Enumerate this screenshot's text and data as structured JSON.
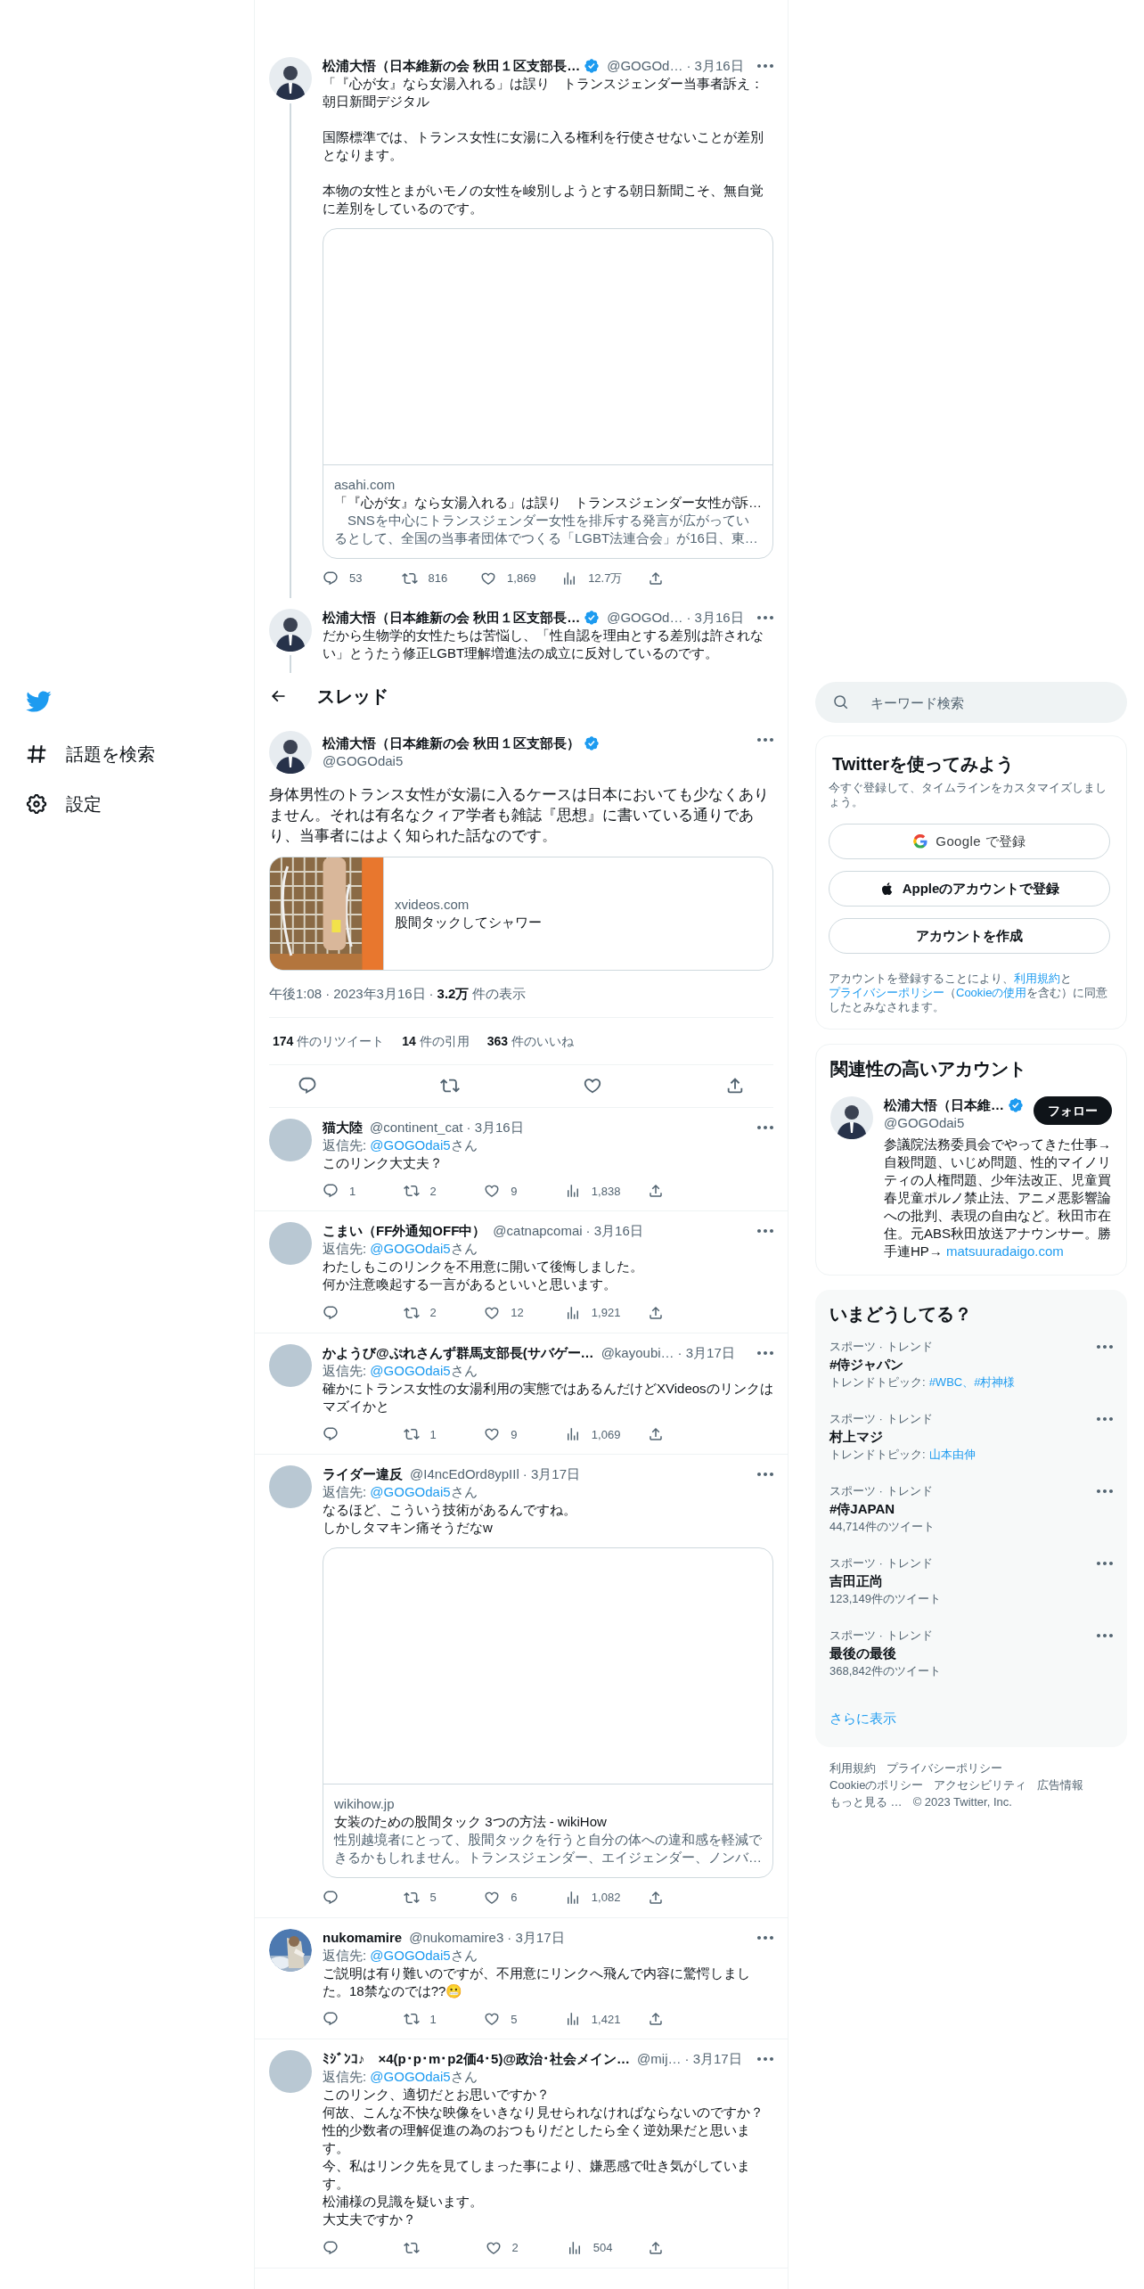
{
  "nav": {
    "items": [
      {
        "label": "話題を検索",
        "kind": "hash"
      },
      {
        "label": "設定",
        "kind": "gear"
      }
    ]
  },
  "context_tweets": [
    {
      "avatar": {
        "kind": "silhouette"
      },
      "name": "松浦大悟（日本維新の会 秋田１区支部長…",
      "verified": true,
      "handle": "@GOGOd…",
      "date": "· 3月16日",
      "paragraphs": [
        "「『心が女』なら女湯入れる」は誤り　トランスジェンダー当事者訴え：朝日新聞デジタル",
        "国際標準では、トランス女性に女湯に入る権利を行使させないことが差別となります。",
        "本物の女性とまがいモノの女性を峻別しようとする朝日新聞こそ、無自覚に差別をしているのです。"
      ],
      "card": {
        "kind": "large",
        "domain": "asahi.com",
        "title": "「『心が女』なら女湯入れる」は誤り　トランスジェンダー女性が訴…",
        "description": "　SNSを中心にトランスジェンダー女性を排斥する発言が広がっているとして、全国の当事者団体でつくる「LGBT法連合会」が16日、東…"
      },
      "actions": [
        {
          "kind": "reply",
          "count": "53"
        },
        {
          "kind": "retweet",
          "count": "816"
        },
        {
          "kind": "like",
          "count": "1,869"
        },
        {
          "kind": "views",
          "count": "12.7万"
        },
        {
          "kind": "share"
        }
      ]
    },
    {
      "avatar": {
        "kind": "silhouette"
      },
      "name": "松浦大悟（日本維新の会 秋田１区支部長…",
      "verified": true,
      "handle": "@GOGOd…",
      "date": "· 3月16日",
      "lines": [
        "だから生物学的女性たちは苦悩し、「性自認を理由とする差別は許されない」とうたう修正LGBT理解増進法の成立に反対しているのです。"
      ]
    }
  ],
  "header": {
    "title": "スレッド"
  },
  "main_tweet": {
    "avatar": {
      "kind": "silhouette"
    },
    "name": "松浦大悟（日本維新の会 秋田１区支部長）",
    "verified": true,
    "handle": "@GOGOdai5",
    "lines": [
      "身体男性のトランス女性が女湯に入るケースは日本においても少なくありません。それは有名なクィア学者も雑誌『思想』に書いている通りであり、当事者にはよく知られた話なのです。"
    ],
    "card": {
      "kind": "small",
      "domain": "xvideos.com",
      "title": "股間タックしてシャワー"
    },
    "meta": [
      {
        "kind": "text",
        "text": "午後1:08"
      },
      {
        "kind": "sep",
        "text": "·"
      },
      {
        "kind": "text",
        "text": "2023年3月16日"
      },
      {
        "kind": "sep",
        "text": "·"
      },
      {
        "kind": "count",
        "text": "3.2万"
      },
      {
        "kind": "text",
        "text": "件の表示"
      }
    ],
    "stats": [
      {
        "count": "174",
        "label": "件のリツイート"
      },
      {
        "count": "14",
        "label": "件の引用"
      },
      {
        "count": "363",
        "label": "件のいいね"
      }
    ],
    "actions": [
      {
        "kind": "reply"
      },
      {
        "kind": "retweet"
      },
      {
        "kind": "like"
      },
      {
        "kind": "share"
      }
    ]
  },
  "replies": [
    {
      "avatar": {
        "kind": "plain"
      },
      "name": "猫大陸",
      "verified": false,
      "handle": "@continent_cat",
      "date": "· 3月16日",
      "reply_to": {
        "label": "返信先:",
        "handle": "@GOGOdai5",
        "suffix": "さん"
      },
      "lines": [
        "このリンク大丈夫？"
      ],
      "actions": [
        {
          "kind": "reply",
          "count": "1"
        },
        {
          "kind": "retweet",
          "count": "2"
        },
        {
          "kind": "like",
          "count": "9"
        },
        {
          "kind": "views",
          "count": "1,838"
        },
        {
          "kind": "share"
        }
      ]
    },
    {
      "avatar": {
        "kind": "plain"
      },
      "name": "こまい（FF外通知OFF中）",
      "verified": false,
      "handle": "@catnapcomai",
      "date": "· 3月16日",
      "reply_to": {
        "label": "返信先:",
        "handle": "@GOGOdai5",
        "suffix": "さん"
      },
      "lines": [
        "わたしもこのリンクを不用意に開いて後悔しました。",
        "何か注意喚起する一言があるといいと思います。"
      ],
      "actions": [
        {
          "kind": "reply"
        },
        {
          "kind": "retweet",
          "count": "2"
        },
        {
          "kind": "like",
          "count": "12"
        },
        {
          "kind": "views",
          "count": "1,921"
        },
        {
          "kind": "share"
        }
      ]
    },
    {
      "avatar": {
        "kind": "plain"
      },
      "name": "かようび@ぷれさんず群馬支部長(サバゲー…",
      "verified": false,
      "handle": "@kayoubi…",
      "date": "· 3月17日",
      "reply_to": {
        "label": "返信先:",
        "handle": "@GOGOdai5",
        "suffix": "さん"
      },
      "lines": [
        "確かにトランス女性の女湯利用の実態ではあるんだけどXVideosのリンクはマズイかと"
      ],
      "actions": [
        {
          "kind": "reply"
        },
        {
          "kind": "retweet",
          "count": "1"
        },
        {
          "kind": "like",
          "count": "9"
        },
        {
          "kind": "views",
          "count": "1,069"
        },
        {
          "kind": "share"
        }
      ]
    },
    {
      "avatar": {
        "kind": "plain"
      },
      "name": "ライダー違反",
      "verified": false,
      "handle": "@I4ncEdOrd8ypIIl",
      "date": "· 3月17日",
      "reply_to": {
        "label": "返信先:",
        "handle": "@GOGOdai5",
        "suffix": "さん"
      },
      "lines": [
        "なるほど、こういう技術があるんですね。",
        "しかしタマキン痛そうだなw"
      ],
      "card": {
        "kind": "large",
        "domain": "wikihow.jp",
        "title": "女装のための股間タック 3つの方法 - wikiHow",
        "description": "性別越境者にとって、股間タックを行うと自分の体への違和感を軽減できるかもしれません。トランスジェンダー、エイジェンダー、ノンバ…"
      },
      "actions": [
        {
          "kind": "reply"
        },
        {
          "kind": "retweet",
          "count": "5"
        },
        {
          "kind": "like",
          "count": "6"
        },
        {
          "kind": "views",
          "count": "1,082"
        },
        {
          "kind": "share"
        }
      ]
    },
    {
      "avatar": {
        "kind": "picture"
      },
      "name": "nukomamire",
      "verified": false,
      "handle": "@nukomamire3",
      "date": "· 3月17日",
      "reply_to": {
        "label": "返信先:",
        "handle": "@GOGOdai5",
        "suffix": "さん"
      },
      "lines": [
        "ご説明は有り難いのですが、不用意にリンクへ飛んで内容に驚愕しました。18禁なのでは??😬"
      ],
      "actions": [
        {
          "kind": "reply"
        },
        {
          "kind": "retweet",
          "count": "1"
        },
        {
          "kind": "like",
          "count": "5"
        },
        {
          "kind": "views",
          "count": "1,421"
        },
        {
          "kind": "share"
        }
      ]
    },
    {
      "avatar": {
        "kind": "plain"
      },
      "name": "ﾐｼﾞﾝｺ♪　×4(p･p･m･p2価4･5)@政治･社会メイン…",
      "verified": false,
      "handle": "@mij…",
      "date": "· 3月17日",
      "reply_to": {
        "label": "返信先:",
        "handle": "@GOGOdai5",
        "suffix": "さん"
      },
      "lines": [
        "このリンク、適切だとお思いですか？",
        "何故、こんな不快な映像をいきなり見せられなければならないのですか？",
        "性的少数者の理解促進の為のおつもりだとしたら全く逆効果だと思います。",
        "今、私はリンク先を見てしまった事により、嫌悪感で吐き気がしています。",
        "松浦様の見識を疑います。",
        "大丈夫ですか？"
      ],
      "actions": [
        {
          "kind": "reply"
        },
        {
          "kind": "retweet"
        },
        {
          "kind": "like",
          "count": "2"
        },
        {
          "kind": "views",
          "count": "504"
        },
        {
          "kind": "share"
        }
      ]
    }
  ],
  "sidebar": {
    "search": {
      "placeholder": "キーワード検索"
    },
    "signup": {
      "title": "Twitterを使ってみよう",
      "subtitle": "今すぐ登録して、タイムラインをカスタマイズしましょう。",
      "buttons": [
        {
          "kind": "google",
          "label": "Google で登録"
        },
        {
          "kind": "apple",
          "label": "Appleのアカウントで登録"
        },
        {
          "kind": "plain",
          "label": "アカウントを作成"
        }
      ],
      "legal": [
        {
          "text": "アカウントを登録することにより、",
          "link": false
        },
        {
          "text": "利用規約",
          "link": true
        },
        {
          "text": "と",
          "link": false
        },
        {
          "text": "プライバシーポリシー",
          "link": true
        },
        {
          "text": "（",
          "link": false
        },
        {
          "text": "Cookieの使用",
          "link": true
        },
        {
          "text": "を含む）に同意したとみなされます。",
          "link": false
        }
      ]
    },
    "follow": {
      "title": "関連性の高いアカウント",
      "users": [
        {
          "avatar": {
            "kind": "silhouette"
          },
          "name": "松浦大悟（日本維…",
          "verified": true,
          "handle": "@GOGOdai5",
          "button": "フォロー",
          "bio": "参議院法務委員会でやってきた仕事→自殺問題、いじめ問題、性的マイノリティの人権問題、少年法改正、児童買春児童ポルノ禁止法、アニメ悪影響論への批判、表現の自由など。秋田市在住。元ABS秋田放送アナウンサー。勝手連HP→ ",
          "bio_link": "matsuuradaigo.com"
        }
      ]
    },
    "trends": {
      "title": "いまどうしてる？",
      "items": [
        {
          "category": "スポーツ · トレンド",
          "name": "#侍ジャパン",
          "kind": "topics",
          "label": "トレンドトピック:",
          "topics": "#WBC、#村神様"
        },
        {
          "category": "スポーツ · トレンド",
          "name": "村上マジ",
          "kind": "topics",
          "label": "トレンドトピック:",
          "topics": "山本由伸"
        },
        {
          "category": "スポーツ · トレンド",
          "name": "#侍JAPAN",
          "kind": "count",
          "count": "44,714件のツイート"
        },
        {
          "category": "スポーツ · トレンド",
          "name": "吉田正尚",
          "kind": "count",
          "count": "123,149件のツイート"
        },
        {
          "category": "スポーツ · トレンド",
          "name": "最後の最後",
          "kind": "count",
          "count": "368,842件のツイート"
        }
      ],
      "more": "さらに表示"
    },
    "footer": {
      "links": [
        "利用規約",
        "プライバシーポリシー",
        "Cookieのポリシー",
        "アクセシビリティ",
        "広告情報",
        "もっと見る …"
      ],
      "copyright": "© 2023 Twitter, Inc."
    }
  }
}
